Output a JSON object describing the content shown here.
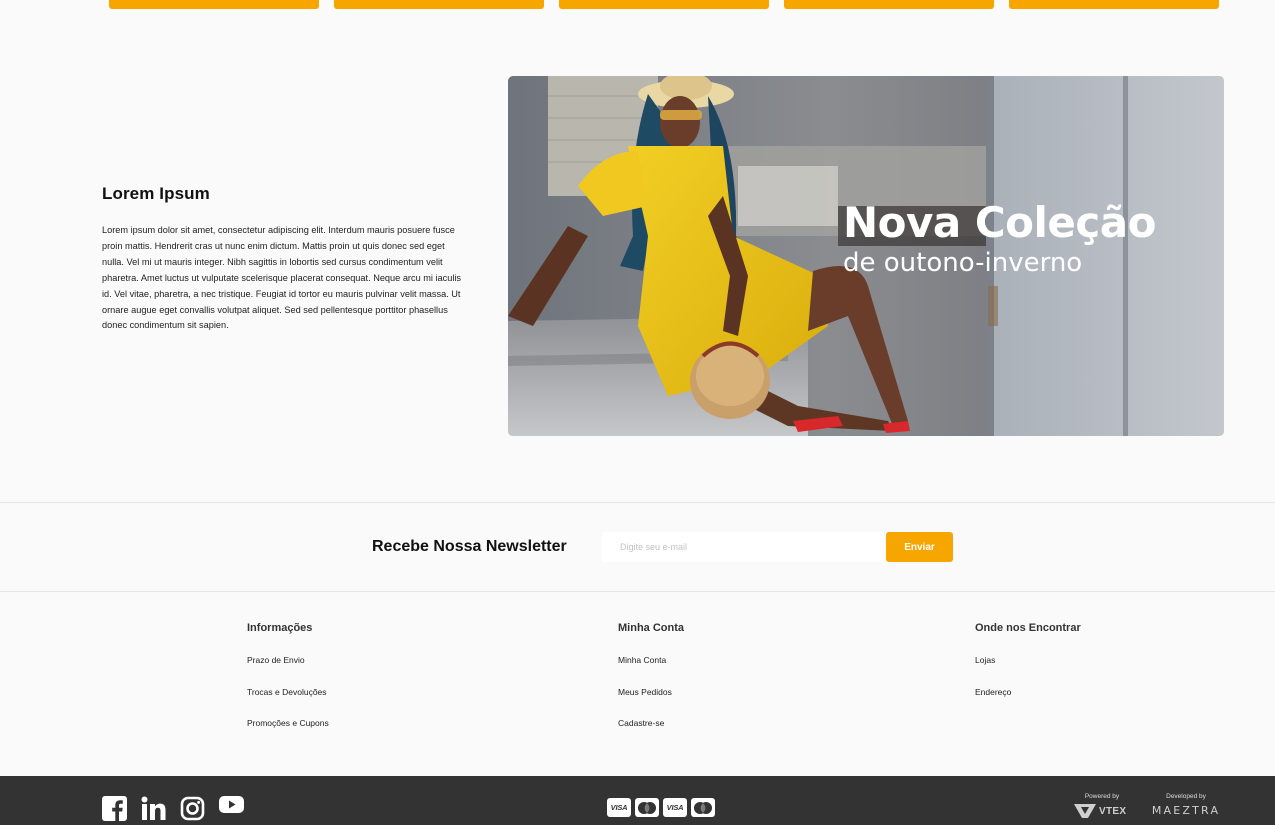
{
  "top_buttons": [
    {
      "label": ""
    },
    {
      "label": ""
    },
    {
      "label": ""
    },
    {
      "label": ""
    },
    {
      "label": ""
    }
  ],
  "hero": {
    "title": "Lorem Ipsum",
    "body": "Lorem ipsum dolor sit amet, consectetur adipiscing elit. Interdum mauris posuere fusce proin mattis. Hendrerit cras ut nunc enim dictum. Mattis proin ut quis donec sed eget nulla. Vel mi ut mauris integer. Nibh sagittis in lobortis sed cursus condimentum velit pharetra. Amet luctus ut vulputate scelerisque placerat consequat. Neque arcu mi iaculis id. Vel vitae, pharetra, a nec tristique. Feugiat id tortor eu mauris pulvinar velit massa. Ut ornare augue eget convallis volutpat aliquet. Sed sed pellentesque porttitor phasellus donec condimentum sit sapien.",
    "banner_title": "Nova Coleção",
    "banner_subtitle": "de outono-inverno"
  },
  "newsletter": {
    "title": "Recebe Nossa Newsletter",
    "placeholder": "Digite seu e-mail",
    "button_label": "Enviar"
  },
  "footer": {
    "columns": [
      {
        "title": "Informações",
        "links": [
          "Prazo de Envio",
          "Trocas e Devoluções",
          "Promoções e Cupons"
        ]
      },
      {
        "title": "Minha Conta",
        "links": [
          "Minha Conta",
          "Meus Pedidos",
          "Cadastre-se"
        ]
      },
      {
        "title": "Onde nos Encontrar",
        "links": [
          "Lojas",
          "Endereço"
        ]
      }
    ],
    "social_icons": [
      "facebook-icon",
      "linkedin-icon",
      "instagram-icon",
      "youtube-icon"
    ],
    "payments": [
      {
        "name": "visa",
        "label": "VISA"
      },
      {
        "name": "mastercard",
        "label": ""
      },
      {
        "name": "visa",
        "label": "VISA"
      },
      {
        "name": "mastercard",
        "label": ""
      }
    ],
    "powered_by_label": "Powered by",
    "powered_by_brand": "VTEX",
    "developed_by_label": "Developed by",
    "developed_by_brand": "MAEZTRA"
  },
  "colors": {
    "accent": "#f7a600",
    "background": "#fafafa",
    "bottom_bar": "#333333"
  }
}
